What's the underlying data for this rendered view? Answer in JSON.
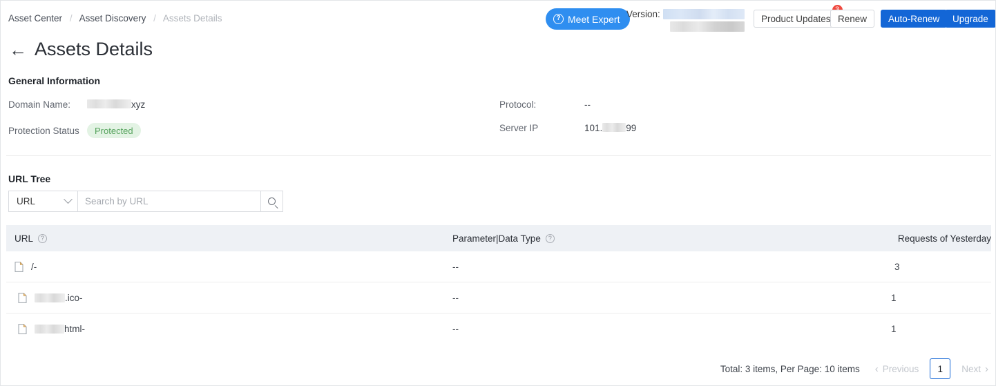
{
  "breadcrumb": {
    "items": [
      {
        "label": "Asset Center",
        "current": false
      },
      {
        "label": "Asset Discovery",
        "current": false
      },
      {
        "label": "Assets Details",
        "current": true
      }
    ],
    "separator": "/"
  },
  "topbar": {
    "meet_expert_label": "Meet Expert",
    "meet_expert_icon": "question-circle-icon",
    "version_label": "Version:",
    "product_updates_label": "Product Updates",
    "product_updates_badge": "3",
    "renew_label": "Renew",
    "auto_renew_label": "Auto-Renew",
    "upgrade_label": "Upgrade"
  },
  "header": {
    "back_icon": "back-arrow-icon",
    "title": "Assets Details"
  },
  "general_information": {
    "section_title": "General Information",
    "domain_name_label": "Domain Name:",
    "domain_name_value": "xyz",
    "protection_status_label": "Protection Status",
    "protection_status_value": "Protected",
    "protocol_label": "Protocol:",
    "protocol_value": "--",
    "server_ip_label": "Server IP",
    "server_ip_prefix": "101.",
    "server_ip_suffix": "99"
  },
  "url_tree": {
    "section_title": "URL Tree",
    "filter_selected": "URL",
    "filter_icon": "chevron-down-icon",
    "search_placeholder": "Search by URL",
    "search_value": "",
    "search_icon": "search-icon",
    "columns": [
      {
        "label": "URL",
        "help": "?"
      },
      {
        "label": "Parameter|Data Type",
        "help": "?"
      },
      {
        "label": "Requests of Yesterday",
        "help": ""
      }
    ],
    "rows": [
      {
        "icon": "document-icon",
        "url": "/-",
        "redacted": false,
        "indent": 0,
        "param": "--",
        "requests": "3"
      },
      {
        "icon": "document-icon",
        "url": ".ico-",
        "redacted": true,
        "indent": 5,
        "param": "--",
        "requests": "1"
      },
      {
        "icon": "document-icon",
        "url": "html-",
        "redacted": true,
        "indent": 5,
        "param": "--",
        "requests": "1"
      }
    ]
  },
  "pagination": {
    "total_text": "Total: 3 items, Per Page: 10 items",
    "previous_label": "Previous",
    "next_label": "Next",
    "current_page": "1",
    "prev_icon": "chevron-left-icon",
    "next_icon": "chevron-right-icon"
  },
  "colors": {
    "primary_blue": "#1366d6",
    "accent_blue": "#2f8ef0",
    "badge_red": "#f0483e",
    "status_green_text": "#55a25c",
    "status_green_bg": "#e3f3e4",
    "table_header_bg": "#eef1f5"
  }
}
